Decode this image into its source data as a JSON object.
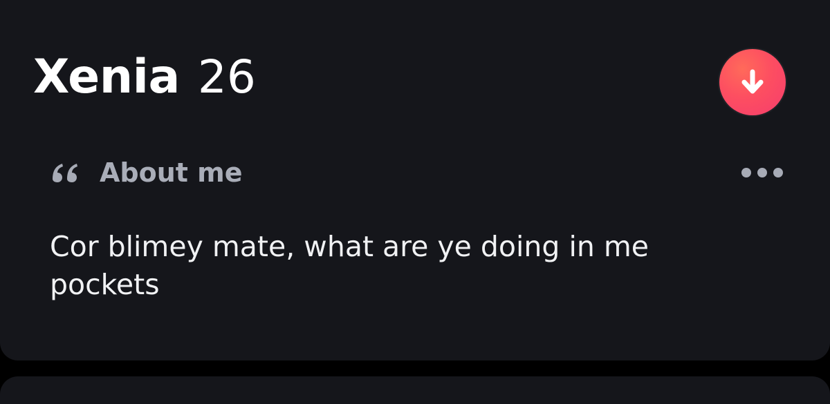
{
  "profile": {
    "name": "Xenia",
    "age": "26"
  },
  "about": {
    "section_title": "About me",
    "bio": "Cor blimey mate, what are ye doing in me pockets"
  },
  "icons": {
    "collapse": "arrow-down-icon",
    "quote": "quote-icon",
    "more": "more-dots-icon"
  },
  "colors": {
    "background": "#15161b",
    "accent_gradient_start": "#ff6a5a",
    "accent_gradient_end": "#f53d6d",
    "muted_text": "#a7abb6",
    "primary_text": "#ffffff"
  }
}
